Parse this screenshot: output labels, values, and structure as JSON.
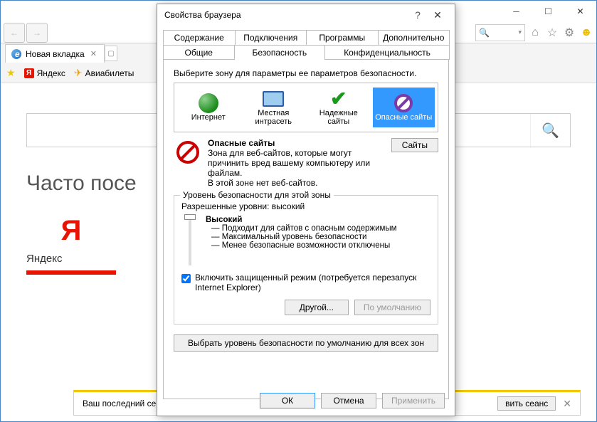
{
  "browser": {
    "tab_title": "Новая вкладка",
    "favorites": {
      "yandex": "Яндекс",
      "avia": "Авиабилеты"
    },
    "frequent_heading": "Часто посе",
    "tile_letter": "Я",
    "tile_label": "Яндекс",
    "bottom_bar": {
      "text_left": "Ваш последний се",
      "restore_btn": "вить сеанс"
    }
  },
  "dialog": {
    "title": "Свойства браузера",
    "tabs_row1": {
      "content": "Содержание",
      "connections": "Подключения",
      "programs": "Программы",
      "advanced": "Дополнительно"
    },
    "tabs_row2": {
      "general": "Общие",
      "security": "Безопасность",
      "privacy": "Конфиденциальность"
    },
    "zone_prompt": "Выберите зону для параметры ее параметров безопасности.",
    "zones": {
      "internet": "Интернет",
      "intranet": "Местная интрасеть",
      "trusted": "Надежные сайты",
      "restricted": "Опасные сайты"
    },
    "selected_zone": {
      "name": "Опасные сайты",
      "desc1": "Зона для веб-сайтов, которые могут причинить вред вашему компьютеру или файлам.",
      "desc2": "В этой зоне нет веб-сайтов.",
      "sites_btn": "Сайты"
    },
    "level_group_legend": "Уровень безопасности для этой зоны",
    "allowed_levels": "Разрешенные уровни: высокий",
    "level": {
      "name": "Высокий",
      "b1": "— Подходит для сайтов с опасным содержимым",
      "b2": "— Максимальный уровень безопасности",
      "b3": "— Менее безопасные возможности отключены"
    },
    "protected_mode": "Включить защищенный режим (потребуется перезапуск Internet Explorer)",
    "custom_btn": "Другой...",
    "default_btn": "По умолчанию",
    "reset_all_btn": "Выбрать уровень безопасности по умолчанию для всех зон",
    "footer": {
      "ok": "ОК",
      "cancel": "Отмена",
      "apply": "Применить"
    }
  }
}
